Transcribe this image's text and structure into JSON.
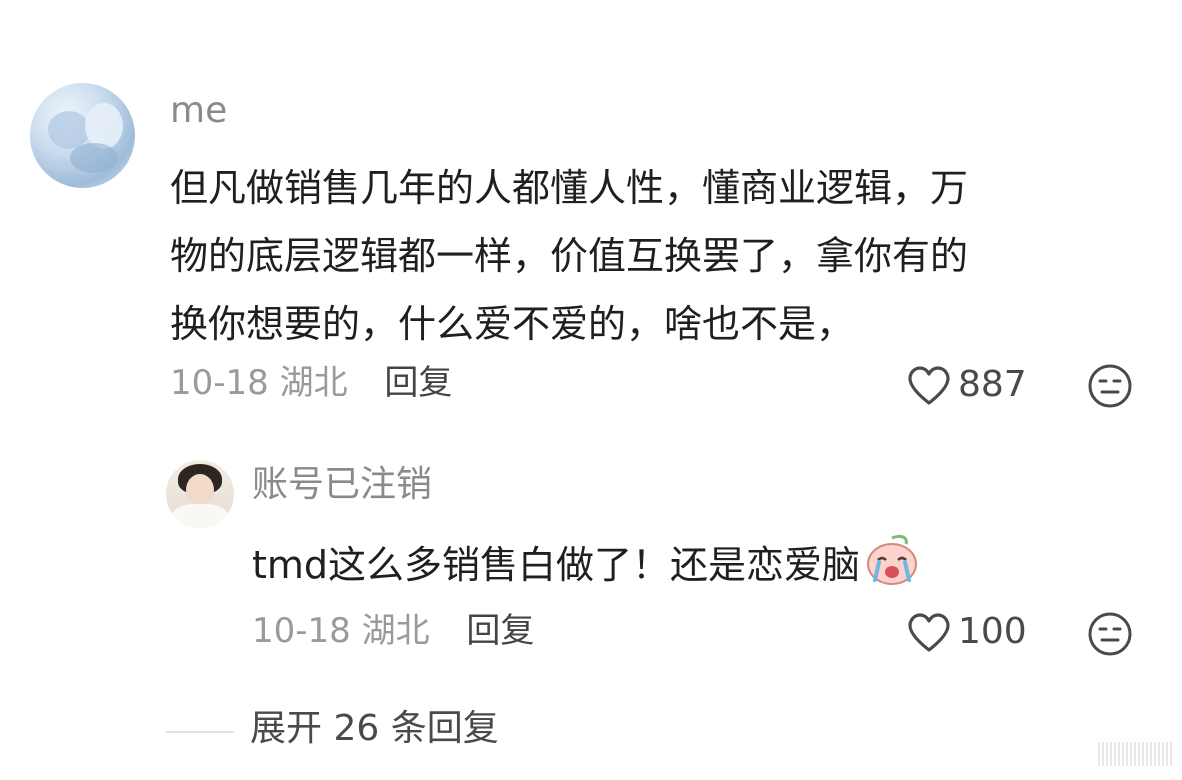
{
  "main_comment": {
    "username": "me",
    "lines": [
      "但凡做销售几年的人都懂人性，懂商业逻辑，万",
      "物的底层逻辑都一样，价值互换罢了，拿你有的",
      "换你想要的，什么爱不爱的，啥也不是，"
    ],
    "date": "10-18",
    "location": "湖北",
    "reply_label": "回复",
    "likes": "887",
    "like_icon": "heart-outline-icon",
    "dislike_icon": "neutral-face-icon"
  },
  "reply_comment": {
    "username": "账号已注销",
    "text": "tmd这么多销售白做了！还是恋爱脑",
    "emoji": "crying-peach-emoji",
    "date": "10-18",
    "location": "湖北",
    "reply_label": "回复",
    "likes": "100"
  },
  "expand": {
    "label": "展开 26 条回复"
  },
  "colors": {
    "text": "#1f1f1f",
    "muted": "#9a9a9a",
    "username": "#8a8a8a",
    "action": "#444444"
  }
}
